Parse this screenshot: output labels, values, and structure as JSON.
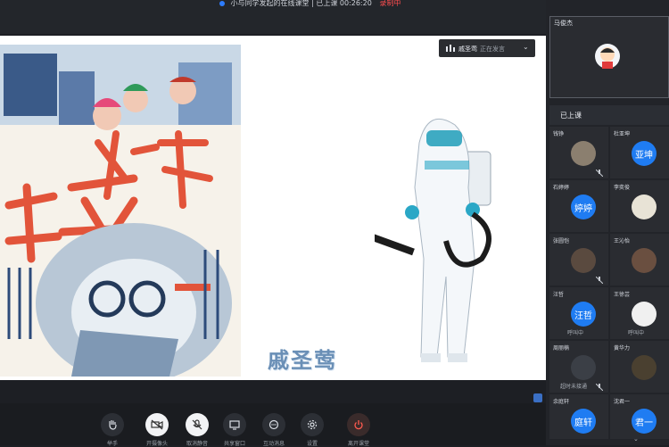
{
  "header": {
    "title": "小与同学发起的在线课堂 | 已上课 00:26:20",
    "recording": "录制中"
  },
  "speaker": {
    "name": "戚圣莺",
    "status": "正在发言"
  },
  "stage": {
    "caption": "戚圣莺"
  },
  "toolbar": {
    "items": [
      {
        "label": "举手"
      },
      {
        "label": "开摄像头"
      },
      {
        "label": "取消静音"
      },
      {
        "label": "共享窗口"
      },
      {
        "label": "互动消息"
      },
      {
        "label": "设置"
      },
      {
        "label": "离开课堂"
      }
    ]
  },
  "sidebar": {
    "teacher": {
      "name": "马俊杰"
    },
    "section_title": "已上课",
    "students": [
      {
        "name": "钱铮",
        "avatar": "photo",
        "avatar_text": "",
        "sub": ""
      },
      {
        "name": "杜亚坤",
        "avatar": "blue",
        "avatar_text": "亚坤",
        "sub": ""
      },
      {
        "name": "石婷婷",
        "avatar": "blue",
        "avatar_text": "婷婷",
        "sub": ""
      },
      {
        "name": "李奕俊",
        "avatar": "photo",
        "avatar_text": "",
        "sub": ""
      },
      {
        "name": "张圆恺",
        "avatar": "photo",
        "avatar_text": "",
        "sub": ""
      },
      {
        "name": "王沁怡",
        "avatar": "photo",
        "avatar_text": "",
        "sub": ""
      },
      {
        "name": "汪哲",
        "avatar": "blue",
        "avatar_text": "汪哲",
        "sub": "呼叫中"
      },
      {
        "name": "王徐芸",
        "avatar": "photo",
        "avatar_text": "",
        "sub": "呼叫中"
      },
      {
        "name": "周丽楠",
        "avatar": "photo",
        "avatar_text": "",
        "sub": "超时未接通"
      },
      {
        "name": "黄华力",
        "avatar": "photo",
        "avatar_text": "",
        "sub": ""
      },
      {
        "name": "余庭轩",
        "avatar": "blue",
        "avatar_text": "庭轩",
        "sub": ""
      },
      {
        "name": "沈君一",
        "avatar": "blue",
        "avatar_text": "君一",
        "sub": ""
      }
    ]
  },
  "colors": {
    "accent": "#1f7cf2",
    "background": "#1d1f24",
    "record": "#ff4d4f"
  }
}
